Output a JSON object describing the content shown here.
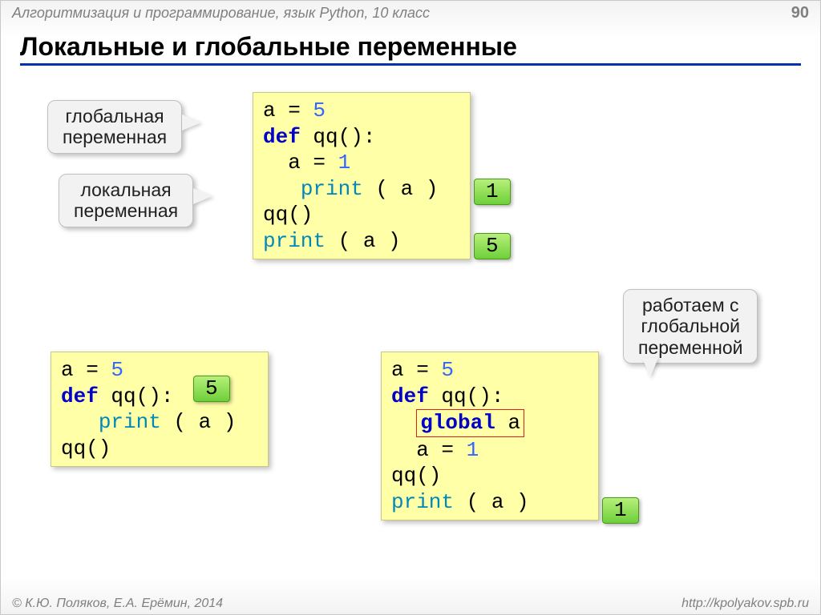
{
  "header": {
    "subject": "Алгоритмизация и программирование, язык Python, 10 класс",
    "page": "90"
  },
  "title": "Локальные и глобальные переменные",
  "callouts": {
    "global": "глобальная\nпеременная",
    "local": "локальная\nпеременная",
    "working": "работаем с\nглобальной\nпеременной"
  },
  "code": {
    "box1": {
      "l1a": "a",
      "l1b": " = ",
      "l1c": "5",
      "l2a": "def",
      "l2b": " qq():",
      "l3a": "  a",
      "l3b": " = ",
      "l3c": "1",
      "l4a": "   ",
      "l4b": "print",
      "l4c": " ( a )",
      "l5": "qq()",
      "l6a": "print",
      "l6b": " ( a )"
    },
    "box2": {
      "l1a": "a",
      "l1b": " = ",
      "l1c": "5",
      "l2a": "def",
      "l2b": " qq():",
      "l3a": "   ",
      "l3b": "print",
      "l3c": " ( a )",
      "l4": "qq()"
    },
    "box3": {
      "l1a": "a",
      "l1b": " = ",
      "l1c": "5",
      "l2a": "def",
      "l2b": " qq():",
      "l3a": "  ",
      "l3b": "global",
      "l3c": " a",
      "l4a": "  a",
      "l4b": " = ",
      "l4c": "1",
      "l5": "qq()",
      "l6a": "print",
      "l6b": " ( a )"
    }
  },
  "badges": {
    "b1": "1",
    "b2": "5",
    "b3": "5",
    "b4": "1"
  },
  "footer": {
    "copyright": "© К.Ю. Поляков, Е.А. Ерёмин, 2014",
    "url": "http://kpolyakov.spb.ru"
  }
}
